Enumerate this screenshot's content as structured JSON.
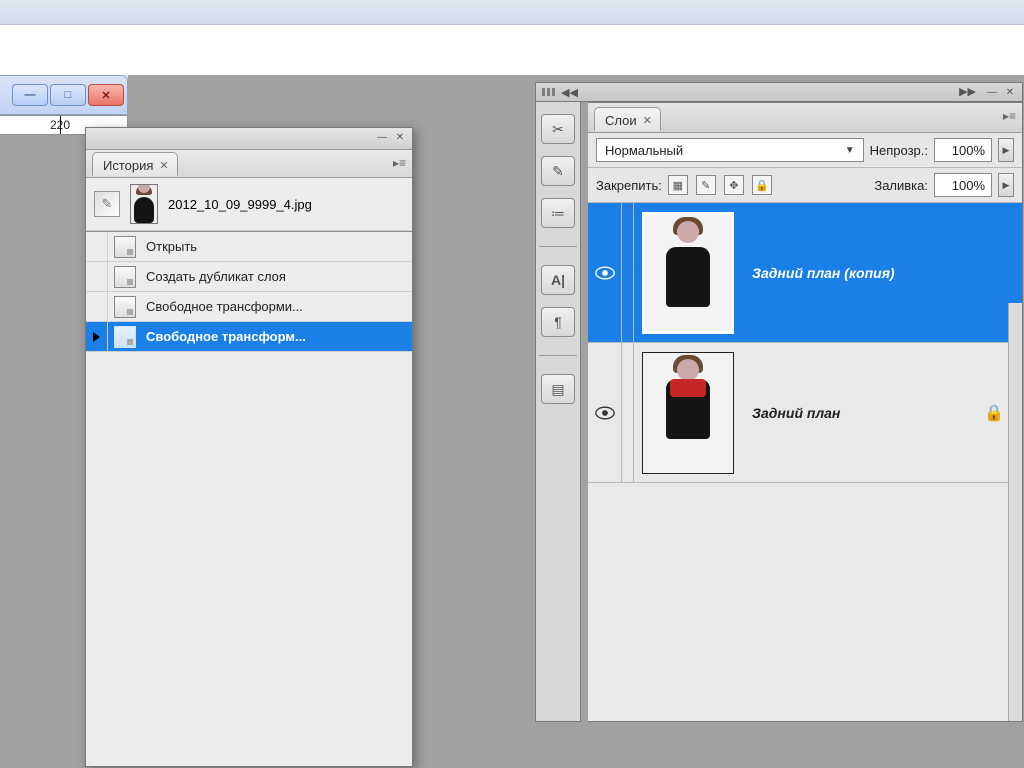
{
  "ruler": {
    "tick_label": "220"
  },
  "history_panel": {
    "tab_title": "История",
    "snapshot_filename": "2012_10_09_9999_4.jpg",
    "steps": [
      {
        "label": "Открыть",
        "selected": false
      },
      {
        "label": "Создать дубликат слоя",
        "selected": false
      },
      {
        "label": "Свободное трансформи...",
        "selected": false
      },
      {
        "label": "Свободное трансформ...",
        "selected": true
      }
    ]
  },
  "layers_panel": {
    "tab_title": "Слои",
    "blend_mode": "Нормальный",
    "opacity_label": "Непрозр.:",
    "opacity_value": "100%",
    "lock_label": "Закрепить:",
    "fill_label": "Заливка:",
    "fill_value": "100%",
    "layers": [
      {
        "name": "Задний план (копия)",
        "visible": true,
        "locked": false,
        "selected": true
      },
      {
        "name": "Задний план",
        "visible": true,
        "locked": true,
        "selected": false
      }
    ]
  }
}
